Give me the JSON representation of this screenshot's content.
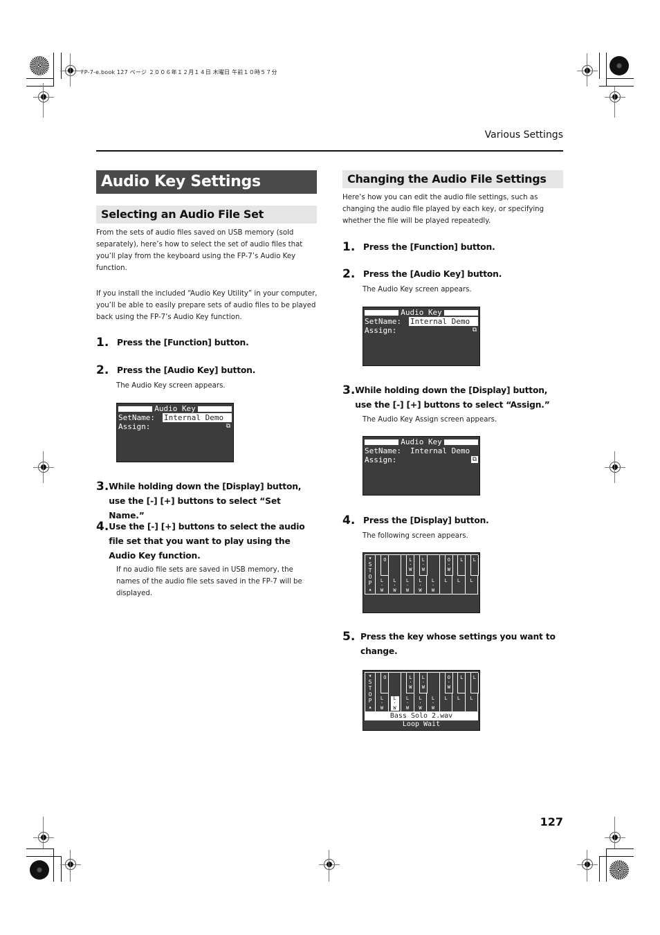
{
  "print_header": "FP-7-e.book  127 ページ  ２００６年１２月１４日  木曜日  午前１０時５７分",
  "running_head": "Various Settings",
  "page_number": "127",
  "main_title": "Audio Key Settings",
  "left": {
    "heading": "Selecting an Audio File Set",
    "intro": "From the sets of audio files saved on USB memory (sold separately), here’s how to select the set of audio files that you’ll play from the keyboard using the FP-7’s Audio Key function.",
    "intro2": "If you install the included “Audio Key Utility” in your computer, you’ll be able to easily prepare sets of audio files to be played back using the FP-7’s Audio Key function.",
    "steps": [
      {
        "num": "1.",
        "text": "Press the [Function] button.",
        "note": ""
      },
      {
        "num": "2.",
        "text": "Press the [Audio Key] button.",
        "note": "The Audio Key screen appears."
      },
      {
        "num": "3.",
        "text": "While holding down the [Display] button, use the [-] [+] buttons to select “Set Name.”",
        "note": ""
      },
      {
        "num": "4.",
        "text": "Use the [-] [+] buttons to select the audio file set that you want to play using the Audio Key function.",
        "note": "If no audio file sets are saved in USB memory, the names of the audio file sets saved in the FP-7 will be displayed."
      }
    ],
    "screen": {
      "title": "Audio Key",
      "row1_label": "SetName:",
      "row1_value": "Internal Demo",
      "row2_label": "Assign:",
      "icon": "⧉"
    }
  },
  "right": {
    "heading": "Changing the Audio File Settings",
    "intro": "Here’s how you can edit the audio file settings, such as changing the audio file played by each key, or specifying whether the file will be played repeatedly.",
    "steps": [
      {
        "num": "1.",
        "text": "Press the [Function] button.",
        "note": ""
      },
      {
        "num": "2.",
        "text": "Press the [Audio Key] button.",
        "note": "The Audio Key screen appears."
      },
      {
        "num": "3.",
        "text": "While holding down the [Display] button, use the [-] [+] buttons to select “Assign.”",
        "note": "The Audio Key Assign screen appears."
      },
      {
        "num": "4.",
        "text": "Press the [Display] button.",
        "note": "The following screen appears."
      },
      {
        "num": "5.",
        "text": "Press the key whose settings you want to change.",
        "note": ""
      }
    ],
    "screen1": {
      "title": "Audio Key",
      "row1_label": "SetName:",
      "row1_value": "Internal Demo",
      "row2_label": "Assign:",
      "icon": "⧉"
    },
    "screen2": {
      "title": "Audio Key",
      "row1_label": "SetName:",
      "row1_value": "Internal Demo",
      "row2_label": "Assign:",
      "icon": "⧉"
    },
    "kbd_screen": {
      "stop_label": "STOP",
      "white_keys": [
        "L·W",
        "L·W",
        "L·W",
        "L·W",
        "L·W",
        "L",
        "L",
        "L"
      ],
      "black_keys": [
        "O",
        "L·W",
        "L·W",
        "O·W",
        "L",
        "L"
      ]
    },
    "kbd_screen2": {
      "stop_label": "STOP",
      "white_keys": [
        "L·W",
        "L·W",
        "L·W",
        "L·W",
        "L·W",
        "L",
        "L",
        "L"
      ],
      "black_keys": [
        "O",
        "L·W",
        "L·W",
        "O·W",
        "L",
        "L"
      ],
      "selected_white_index": 1,
      "file_name": "Bass Solo 2.wav",
      "mode": "Loop Wait"
    }
  }
}
